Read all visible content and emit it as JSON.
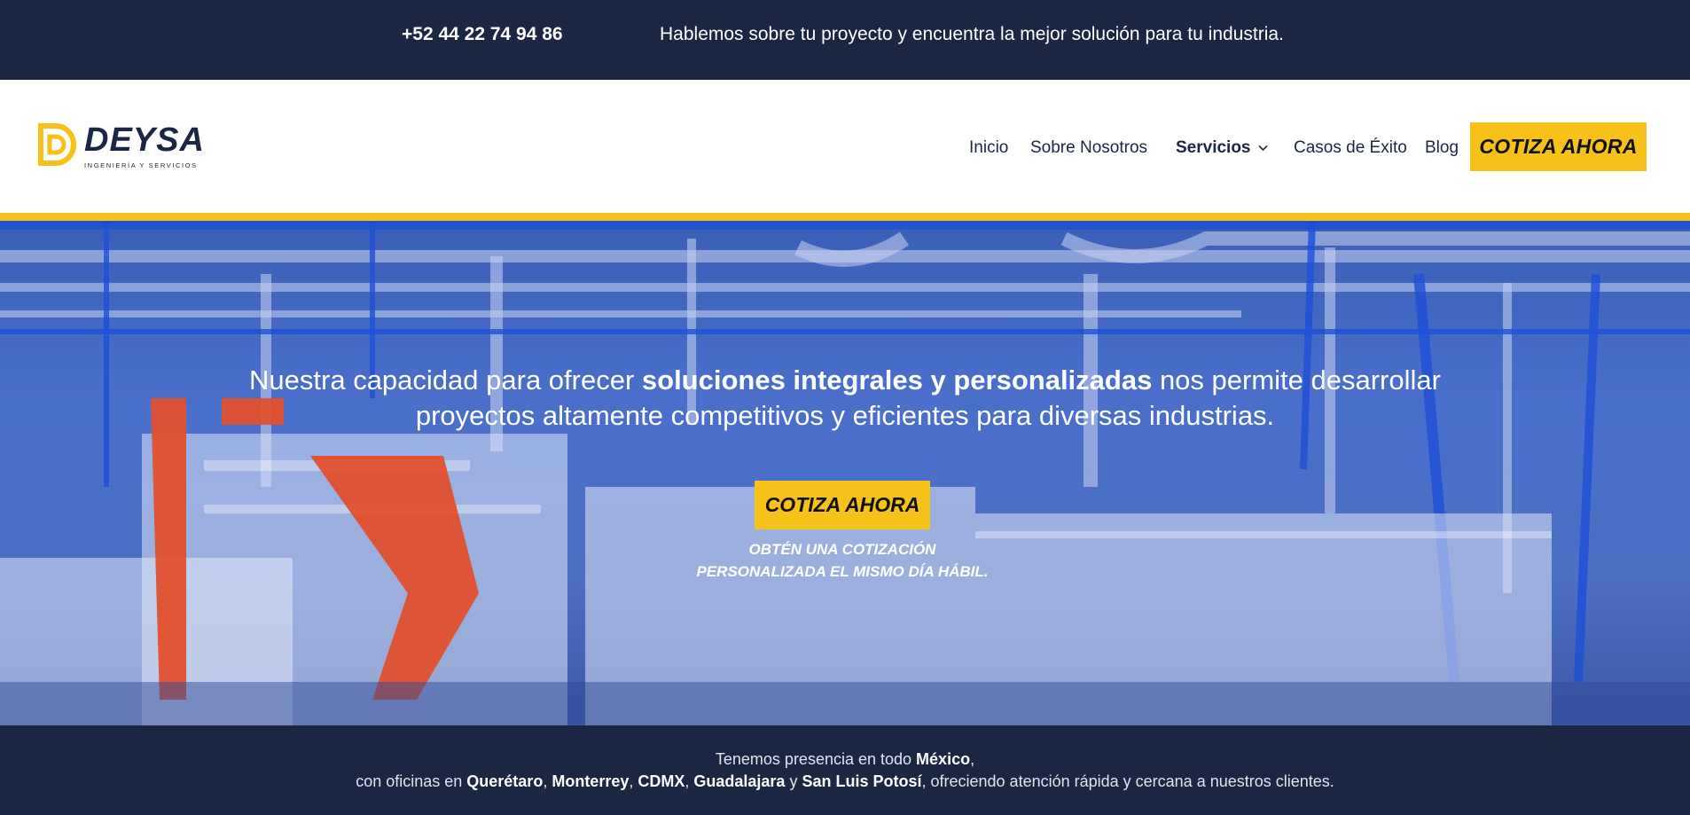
{
  "topbar": {
    "phone": "+52 44 22 74 94 86",
    "tagline": "Hablemos sobre tu proyecto y encuentra la mejor solución para tu industria."
  },
  "logo": {
    "name": "DEYSA",
    "subtitle": "INGENIERÍA Y SERVICIOS",
    "icon": "deysa-logo-mark"
  },
  "nav": {
    "items": [
      {
        "label": "Inicio"
      },
      {
        "label": "Sobre Nosotros"
      },
      {
        "label": "Servicios",
        "has_dropdown": true
      },
      {
        "label": "Casos de Éxito"
      },
      {
        "label": "Blog"
      }
    ],
    "cta_label": "COTIZA AHORA"
  },
  "hero": {
    "headline_pre": "Nuestra capacidad para ofrecer ",
    "headline_bold": "soluciones integrales y personalizadas",
    "headline_post": " nos permite desarrollar proyectos altamente competitivos y eficientes para diversas industrias.",
    "cta_label": "COTIZA AHORA",
    "note_line1": "OBTÉN UNA COTIZACIÓN",
    "note_line2": "PERSONALIZADA EL MISMO DÍA HÁBIL.",
    "background": "industrial-textile-machinery-photo"
  },
  "footer": {
    "line1_pre": "Tenemos presencia en todo ",
    "line1_bold": "México",
    "line1_post": ",",
    "line2_pre": "con oficinas en ",
    "cities": [
      "Querétaro",
      "Monterrey",
      "CDMX",
      "Guadalajara",
      "San Luis Potosí"
    ],
    "sep_comma": ", ",
    "sep_and": " y ",
    "line2_post": ", ofreciendo atención rápida y cercana a nuestros clientes."
  },
  "colors": {
    "navy": "#1b2642",
    "accent_yellow": "#f6c21a",
    "hero_blue": "#4a6fcb"
  }
}
